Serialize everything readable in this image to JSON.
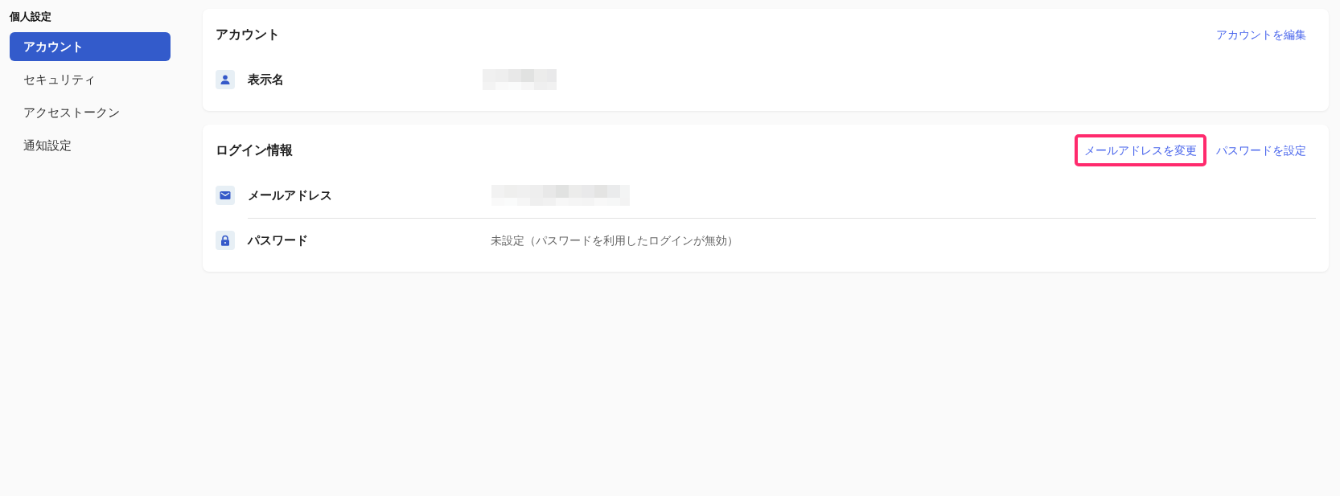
{
  "sidebar": {
    "heading": "個人設定",
    "items": [
      {
        "label": "アカウント",
        "selected": true
      },
      {
        "label": "セキュリティ",
        "selected": false
      },
      {
        "label": "アクセストークン",
        "selected": false
      },
      {
        "label": "通知設定",
        "selected": false
      }
    ]
  },
  "cards": [
    {
      "title": "アカウント",
      "actions": [
        {
          "label": "アカウントを編集",
          "highlighted": false
        }
      ],
      "rows": [
        {
          "kind": "display_name",
          "label": "表示名",
          "redacted": true
        }
      ]
    },
    {
      "title": "ログイン情報",
      "actions": [
        {
          "label": "メールアドレスを変更",
          "highlighted": true
        },
        {
          "label": "パスワードを設定",
          "highlighted": false
        }
      ],
      "rows": [
        {
          "kind": "email",
          "label": "メールアドレス",
          "redacted": true
        },
        {
          "kind": "password",
          "label": "パスワード",
          "value": "未設定（パスワードを利用したログインが無効）"
        }
      ]
    }
  ]
}
